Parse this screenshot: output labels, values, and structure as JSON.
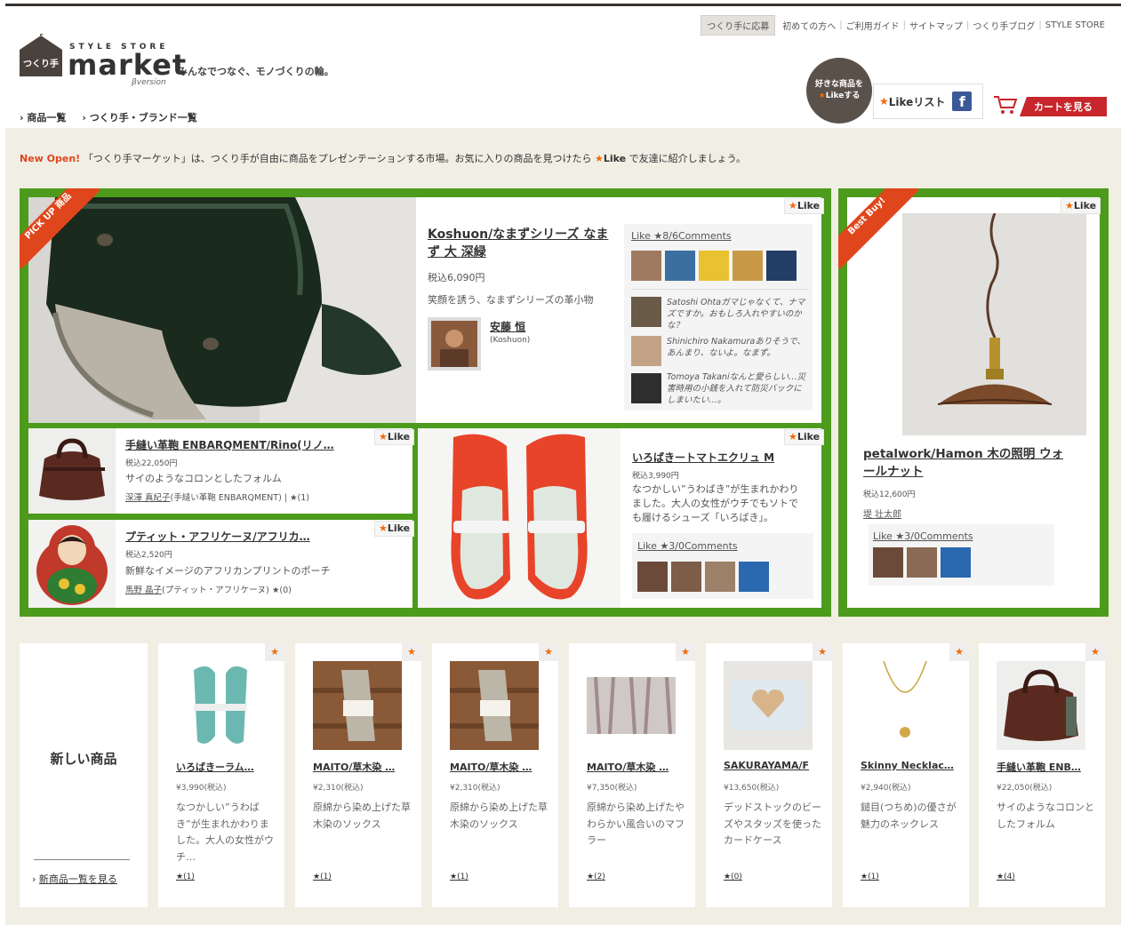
{
  "header": {
    "util_links": [
      "つくり手に応募",
      "初めての方へ",
      "ご利用ガイド",
      "サイトマップ",
      "つくり手ブログ",
      "STYLE STORE"
    ],
    "logo_badge": "つくり手",
    "logo_small": "STYLE STORE",
    "logo_big": "market",
    "logo_beta": "βversion",
    "tagline": "みんなでつなぐ、モノづくりの輪。",
    "nav": [
      "商品一覧",
      "つくり手・ブランド一覧"
    ],
    "like_bubble_1": "好きな商品を",
    "like_bubble_2": "Likeする",
    "like_list": "Likeリスト",
    "cart": "カートを見る"
  },
  "notice": {
    "new_open": "New Open!",
    "text1": "「つくり手マーケット」は、つくり手が自由に商品をプレゼンテーションする市場。お気に入りの商品を見つけたら",
    "like": "Like",
    "text2": "で友達に紹介しましょう。"
  },
  "pickup": {
    "ribbon": "PICK UP 商品",
    "like": "Like",
    "title": "Koshuon/なまずシリーズ なまず 大 深緑",
    "price": "税込6,090円",
    "desc": "笑顔を誘う、なまずシリーズの革小物",
    "maker": "安藤 恒",
    "maker_sub": "(Koshuon)",
    "stats": "Like ★8/6Comments",
    "comments": [
      {
        "name": "Satoshi Ohta",
        "text": "ガマじゃなくて、ナマズですか。おもしろ入れやすいのかな？"
      },
      {
        "name": "Shinichiro Nakamura",
        "text": "ありそうで、あんまり、ないよ。なまず。"
      },
      {
        "name": "Tomoya Takani",
        "text": "なんと愛らしい…災害時用の小銭を入れて防災バックにしまいたい…。"
      }
    ]
  },
  "sub1": {
    "like": "Like",
    "title": "手縫い革鞄 ENBARQMENT/Rino(リノ…",
    "price": "税込22,050円",
    "desc": "サイのようなコロンとしたフォルム",
    "maker": "深澤 真紀子",
    "maker_sub": "(手縫い革鞄 ENBARQMENT)",
    "count": "★(1)"
  },
  "sub2": {
    "like": "Like",
    "title": "プティット・アフリケーヌ/アフリカ…",
    "price": "税込2,520円",
    "desc": "新鮮なイメージのアフリカンプリントのポーチ",
    "maker": "馬野 晶子",
    "maker_sub": "(プティット・アフリケーヌ)",
    "count": "★(0)"
  },
  "sub3": {
    "like": "Like",
    "title": "いろばきートマトエクリュ M",
    "price": "税込3,990円",
    "desc": "なつかしい”うわばき”が生まれかわりました。大人の女性がウチでもソトでも履けるシューズ「いろばき」。",
    "stats": "Like ★3/0Comments"
  },
  "bestbuy": {
    "ribbon": "Best Buy!",
    "like": "Like",
    "title": "petalwork/Hamon 木の照明 ウォールナット",
    "price": "税込12,600円",
    "maker": "堤 壮太郎",
    "stats": "Like ★3/0Comments"
  },
  "new_items": {
    "heading": "新しい商品",
    "link": "新商品一覧を見る",
    "items": [
      {
        "title": "いろばきーラム…",
        "price": "¥3,990(税込)",
        "desc": "なつかしい”うわばき”が生まれかわりました。大人の女性がウチ…",
        "count": "★(1)"
      },
      {
        "title": "MAITO/草木染 …",
        "price": "¥2,310(税込)",
        "desc": "原綿から染め上げた草木染のソックス",
        "count": "★(1)"
      },
      {
        "title": "MAITO/草木染 …",
        "price": "¥2,310(税込)",
        "desc": "原綿から染め上げた草木染のソックス",
        "count": "★(1)"
      },
      {
        "title": "MAITO/草木染 …",
        "price": "¥7,350(税込)",
        "desc": "原綿から染め上げたやわらかい風合いのマフラー",
        "count": "★(2)"
      },
      {
        "title": "SAKURAYAMA/F",
        "price": "¥13,650(税込)",
        "desc": "デッドストックのビーズやスタッズを使ったカードケース",
        "count": "★(0)"
      },
      {
        "title": "Skinny Necklac…",
        "price": "¥2,940(税込)",
        "desc": "鎚目(つちめ)の優さが魅力のネックレス",
        "count": "★(1)"
      },
      {
        "title": "手縫い革鞄 ENB…",
        "price": "¥22,050(税込)",
        "desc": "サイのようなコロンとしたフォルム",
        "count": "★(4)"
      }
    ]
  }
}
